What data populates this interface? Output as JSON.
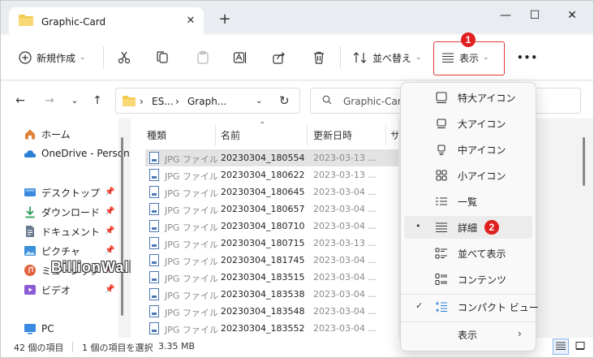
{
  "tab": {
    "title": "Graphic-Card",
    "close": "✕",
    "new": "+"
  },
  "window_controls": {
    "minimize": "—",
    "maximize": "☐",
    "close": "✕"
  },
  "toolbar": {
    "new_label": "新規作成",
    "sort_label": "並べ替え",
    "view_label": "表示",
    "more": "•••",
    "badge1": "1",
    "badge2": "2"
  },
  "address": {
    "crumbs": [
      "ES...",
      "Graph..."
    ],
    "separator": "›",
    "search_placeholder": "Graphic-Card"
  },
  "nav": [
    {
      "label": "ホーム",
      "icon": "home-icon",
      "color": "#e0843c",
      "pinned": false
    },
    {
      "label": "OneDrive - Person",
      "icon": "cloud-icon",
      "color": "#2b7fd6",
      "pinned": false
    },
    {
      "label": "デスクトップ",
      "icon": "desktop-icon",
      "color": "#3a8be0",
      "pinned": true
    },
    {
      "label": "ダウンロード",
      "icon": "download-icon",
      "color": "#2f9e58",
      "pinned": true
    },
    {
      "label": "ドキュメント",
      "icon": "document-icon",
      "color": "#6b7a90",
      "pinned": true
    },
    {
      "label": "ピクチャ",
      "icon": "pictures-icon",
      "color": "#3d8fd8",
      "pinned": true
    },
    {
      "label": "ミュージック",
      "icon": "music-icon",
      "color": "#e2603a",
      "pinned": true
    },
    {
      "label": "ビデオ",
      "icon": "video-icon",
      "color": "#8a5bd6",
      "pinned": true
    },
    {
      "label": "PC",
      "icon": "pc-icon",
      "color": "#3a8be0",
      "pinned": false
    }
  ],
  "columns": {
    "type": "種類",
    "name": "名前",
    "date": "更新日時",
    "size": "サ"
  },
  "files": [
    {
      "type": "JPG ファイル",
      "name": "20230304_180554",
      "date": "2023-03-13 ..."
    },
    {
      "type": "JPG ファイル",
      "name": "20230304_180622",
      "date": "2023-03-13 ..."
    },
    {
      "type": "JPG ファイル",
      "name": "20230304_180645",
      "date": "2023-03-04 ..."
    },
    {
      "type": "JPG ファイル",
      "name": "20230304_180657",
      "date": "2023-03-04 ..."
    },
    {
      "type": "JPG ファイル",
      "name": "20230304_180710",
      "date": "2023-03-04 ..."
    },
    {
      "type": "JPG ファイル",
      "name": "20230304_180715",
      "date": "2023-03-13 ..."
    },
    {
      "type": "JPG ファイル",
      "name": "20230304_181745",
      "date": "2023-03-04 ..."
    },
    {
      "type": "JPG ファイル",
      "name": "20230304_183515",
      "date": "2023-03-04 ..."
    },
    {
      "type": "JPG ファイル",
      "name": "20230304_183538",
      "date": "2023-03-04 ..."
    },
    {
      "type": "JPG ファイル",
      "name": "20230304_183548",
      "date": "2023-03-04 ..."
    },
    {
      "type": "JPG ファイル",
      "name": "20230304_183552",
      "date": "2023-03-04 ..."
    }
  ],
  "status": {
    "count": "42 個の項目",
    "selected": "1 個の項目を選択",
    "size": "3.35 MB"
  },
  "menu": {
    "items": [
      {
        "label": "特大アイコン",
        "icon": "extra-large-icons-icon",
        "mark": ""
      },
      {
        "label": "大アイコン",
        "icon": "large-icons-icon",
        "mark": ""
      },
      {
        "label": "中アイコン",
        "icon": "medium-icons-icon",
        "mark": ""
      },
      {
        "label": "小アイコン",
        "icon": "small-icons-icon",
        "mark": ""
      },
      {
        "label": "一覧",
        "icon": "list-view-icon",
        "mark": ""
      },
      {
        "label": "詳細",
        "icon": "details-view-icon",
        "mark": "•"
      },
      {
        "label": "並べて表示",
        "icon": "tiles-view-icon",
        "mark": ""
      },
      {
        "label": "コンテンツ",
        "icon": "content-view-icon",
        "mark": ""
      },
      {
        "label": "コンパクト ビュー",
        "icon": "compact-view-icon",
        "mark": "✓"
      },
      {
        "label": "表示",
        "icon": "",
        "mark": ""
      }
    ]
  },
  "watermark": "BillionWallet.com",
  "colors": {
    "accent": "#e02020",
    "selection": "#e3e3e3",
    "folder": "#f2c94c"
  }
}
